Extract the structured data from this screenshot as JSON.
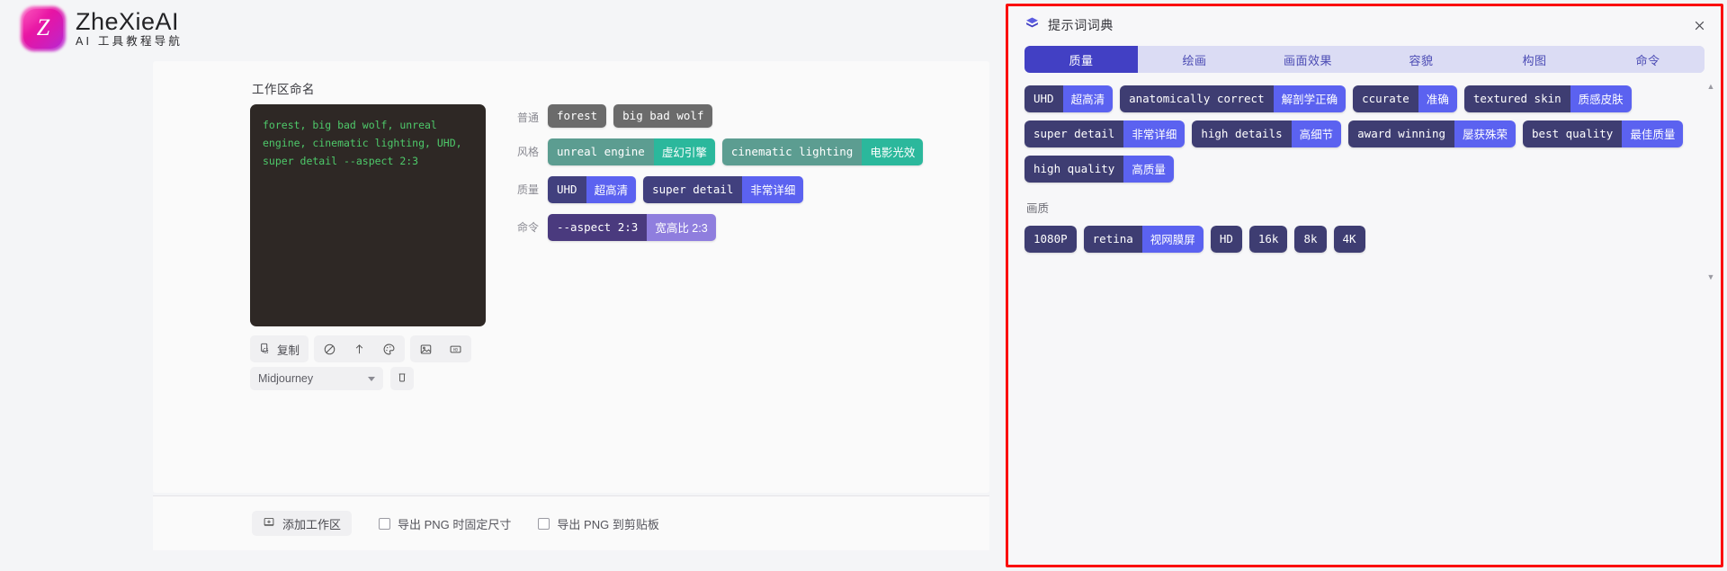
{
  "brand": {
    "logo_letter": "Z",
    "title": "ZheXieAI",
    "subtitle": "AI 工具教程导航"
  },
  "workspace": {
    "name_label": "工作区命名",
    "prompt_text": "forest, big bad wolf, unreal engine, cinematic lighting, UHD, super detail --aspect 2:3",
    "tag_rows": [
      {
        "label": "普通",
        "color": "gray",
        "tags": [
          {
            "en": "forest",
            "cn": ""
          },
          {
            "en": "big bad wolf",
            "cn": ""
          }
        ]
      },
      {
        "label": "风格",
        "color": "teal",
        "tags": [
          {
            "en": "unreal engine",
            "cn": "虚幻引擎"
          },
          {
            "en": "cinematic lighting",
            "cn": "电影光效"
          }
        ]
      },
      {
        "label": "质量",
        "color": "blue",
        "tags": [
          {
            "en": "UHD",
            "cn": "超高清"
          },
          {
            "en": "super detail",
            "cn": "非常详细"
          }
        ]
      },
      {
        "label": "命令",
        "color": "purple",
        "tags": [
          {
            "en": "--aspect 2:3",
            "cn": "宽高比 2:3"
          }
        ]
      }
    ],
    "toolbar": {
      "copy_label": "复制",
      "icons": [
        "clipboard-icon",
        "ban-icon",
        "arrow-up-icon",
        "palette-icon",
        "image-icon",
        "hd-icon"
      ]
    },
    "model_select": {
      "value": "Midjourney"
    },
    "delete_icon": "trash-icon"
  },
  "bottom_bar": {
    "add_workspace_label": "添加工作区",
    "checkbox_fixed_size": "导出 PNG 时固定尺寸",
    "checkbox_to_clipboard": "导出 PNG 到剪贴板",
    "checked_fixed_size": false,
    "checked_to_clipboard": false
  },
  "dictionary": {
    "icon": "book-icon",
    "title": "提示词词典",
    "close_icon": "close-icon",
    "tabs": [
      {
        "label": "质量",
        "active": true
      },
      {
        "label": "绘画",
        "active": false
      },
      {
        "label": "画面效果",
        "active": false
      },
      {
        "label": "容貌",
        "active": false
      },
      {
        "label": "构图",
        "active": false
      },
      {
        "label": "命令",
        "active": false
      }
    ],
    "tags": [
      {
        "en": "UHD",
        "cn": "超高清"
      },
      {
        "en": "anatomically correct",
        "cn": "解剖学正确"
      },
      {
        "en": "ccurate",
        "cn": "准确"
      },
      {
        "en": "textured skin",
        "cn": "质感皮肤"
      },
      {
        "en": "super detail",
        "cn": "非常详细"
      },
      {
        "en": "high details",
        "cn": "高细节"
      },
      {
        "en": "award winning",
        "cn": "屡获殊荣"
      },
      {
        "en": "best quality",
        "cn": "最佳质量"
      },
      {
        "en": "high quality",
        "cn": "高质量"
      }
    ],
    "section_title": "画质",
    "section_tags": [
      {
        "en": "1080P",
        "cn": ""
      },
      {
        "en": "retina",
        "cn": "视网膜屏"
      },
      {
        "en": "HD",
        "cn": ""
      },
      {
        "en": "16k",
        "cn": ""
      },
      {
        "en": "8k",
        "cn": ""
      },
      {
        "en": "4K",
        "cn": ""
      }
    ],
    "scrollbar": {
      "up": "▲",
      "down": "▼"
    }
  },
  "colors": {
    "accent": "#4240c4",
    "panel_border": "#fb0d09",
    "tag_blue_dark": "#3e3d72",
    "tag_blue_light": "#5b62f0",
    "tag_teal": "#2bb89c",
    "terminal_green": "#4ec96a"
  }
}
